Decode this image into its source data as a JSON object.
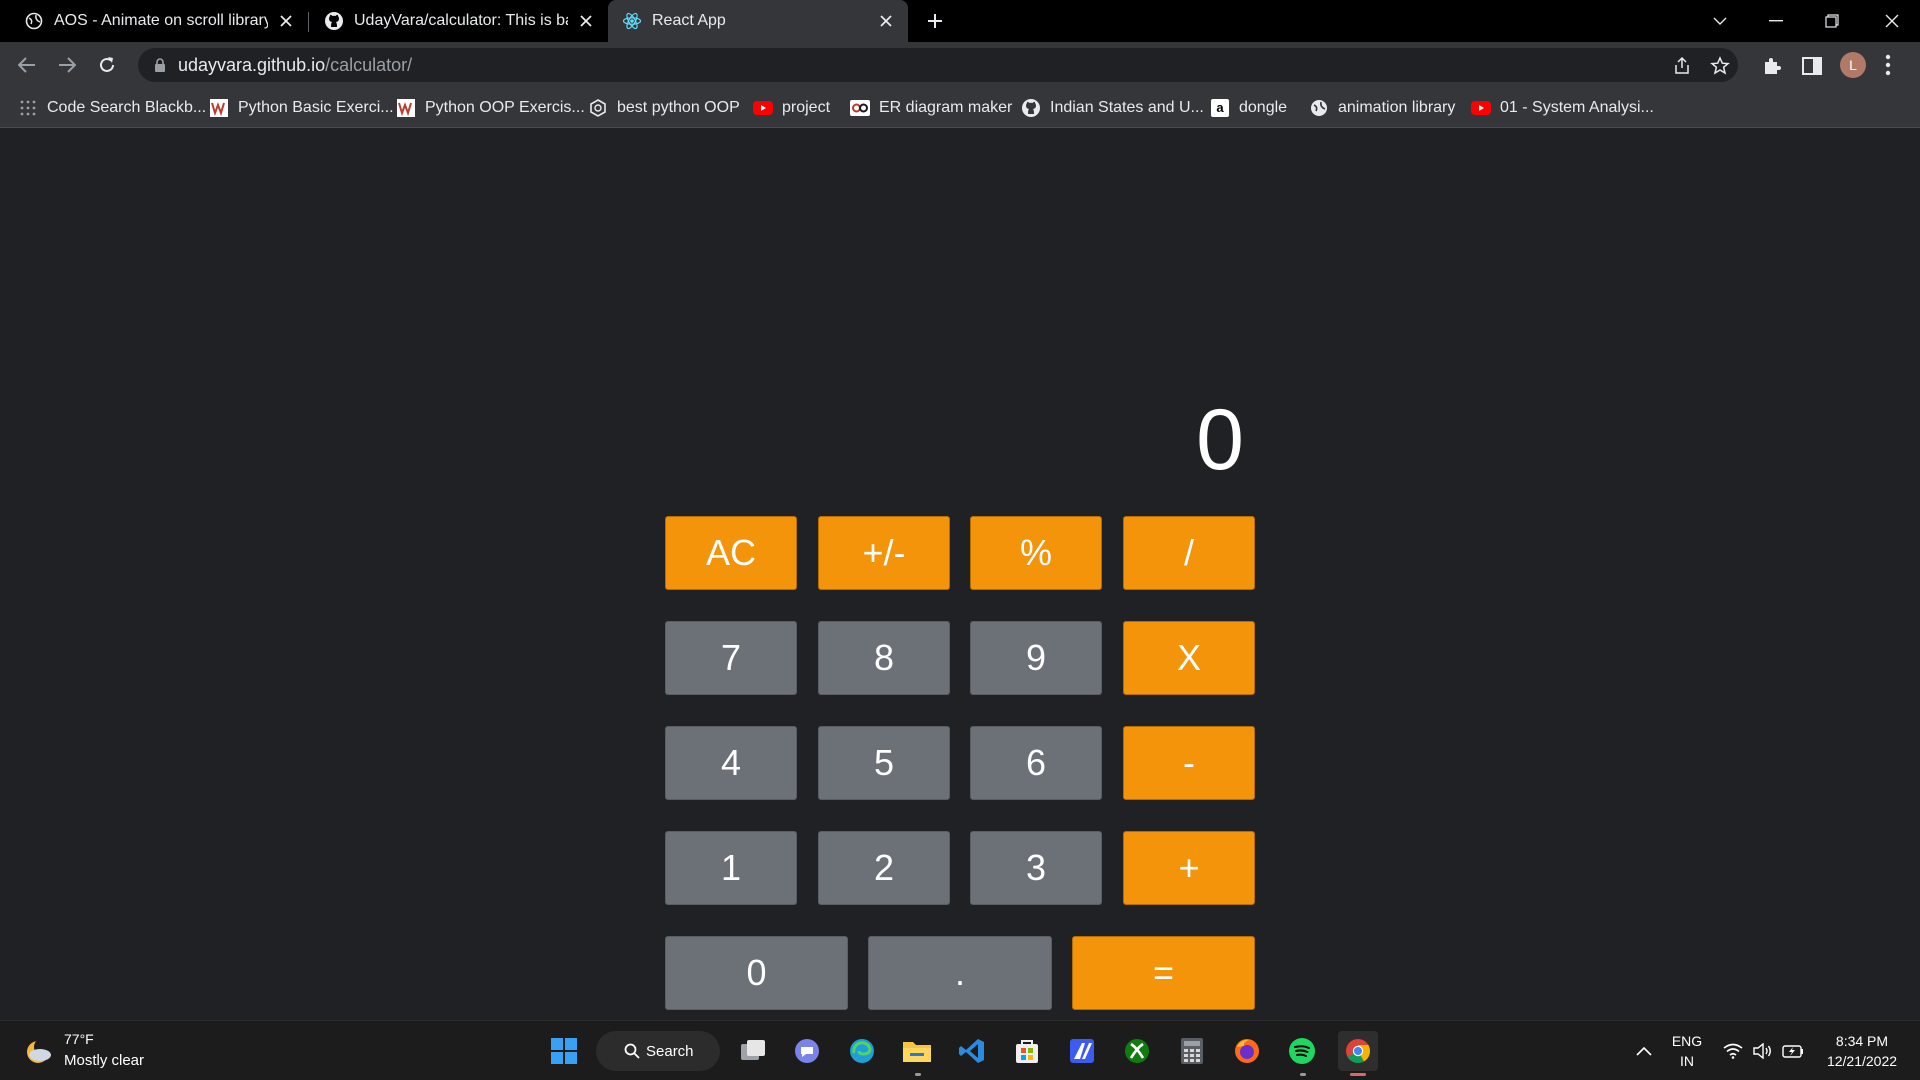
{
  "browser": {
    "tabs": [
      {
        "title": "AOS - Animate on scroll library",
        "active": false
      },
      {
        "title": "UdayVara/calculator: This is basic",
        "active": false
      },
      {
        "title": "React App",
        "active": true
      }
    ],
    "url_host": "udayvara.github.io",
    "url_path": "/calculator/",
    "profile_initial": "L",
    "bookmarks": [
      "Code Search Blackb...",
      "Python Basic Exerci...",
      "Python OOP Exercis...",
      "best python OOP",
      "project",
      "ER diagram maker",
      "Indian States and U...",
      "dongle",
      "animation library",
      "01 - System Analysi..."
    ]
  },
  "calculator": {
    "display": "0",
    "keys": {
      "ac": "AC",
      "sign": "+/-",
      "percent": "%",
      "divide": "/",
      "seven": "7",
      "eight": "8",
      "nine": "9",
      "multiply": "X",
      "four": "4",
      "five": "5",
      "six": "6",
      "minus": "-",
      "one": "1",
      "two": "2",
      "three": "3",
      "plus": "+",
      "zero": "0",
      "decimal": ".",
      "equals": "="
    },
    "colors": {
      "operator": "#f4940a",
      "number": "#6c7178",
      "background": "#202124"
    }
  },
  "taskbar": {
    "weather_temp": "77°F",
    "weather_desc": "Mostly clear",
    "search_label": "Search",
    "language_top": "ENG",
    "language_bottom": "IN",
    "time": "8:34 PM",
    "date": "12/21/2022"
  }
}
